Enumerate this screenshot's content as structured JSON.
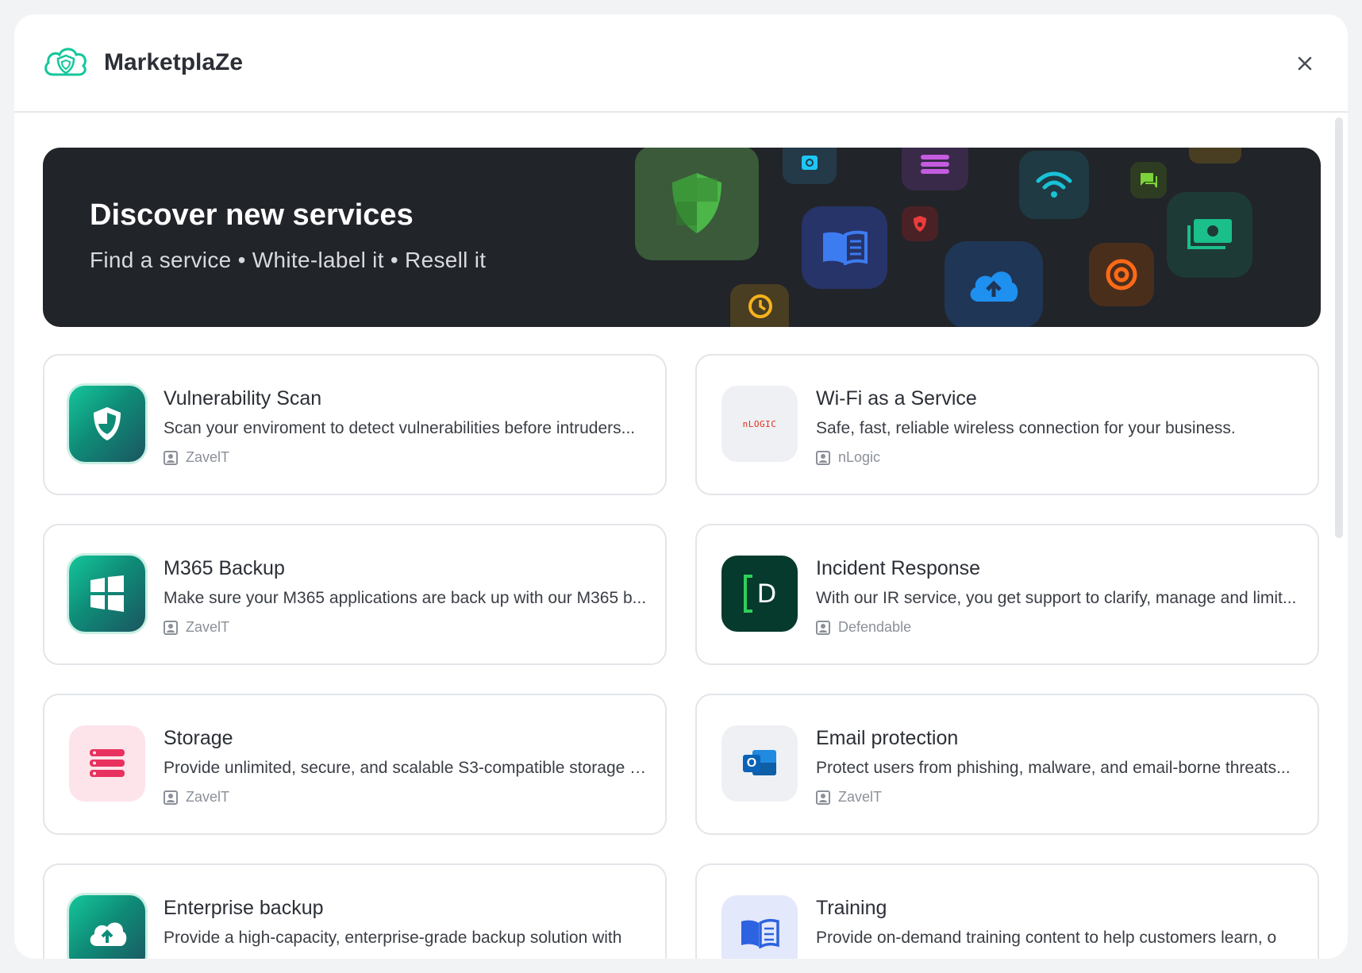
{
  "app": {
    "title": "MarketplaZe"
  },
  "banner": {
    "title": "Discover new services",
    "subtitle": "Find a service • White-label it • Resell it"
  },
  "services": [
    {
      "title": "Vulnerability Scan",
      "description": "Scan your enviroment to detect vulnerabilities before intruders...",
      "vendor": "ZavelT",
      "icon": "shield-icon"
    },
    {
      "title": "Wi-Fi as a Service",
      "description": "Safe, fast, reliable wireless connection for your business.",
      "vendor": "nLogic",
      "icon": "nlogic-logo",
      "logo_text": "nLOGIC"
    },
    {
      "title": "M365 Backup",
      "description": "Make sure your M365 applications are back up with our M365 b...",
      "vendor": "ZavelT",
      "icon": "windows-icon"
    },
    {
      "title": "Incident Response",
      "description": "With our IR service, you get support to clarify, manage and limit...",
      "vendor": "Defendable",
      "icon": "defendable-logo",
      "logo_text": "D"
    },
    {
      "title": "Storage",
      "description": "Provide unlimited, secure, and scalable S3-compatible storage t...",
      "vendor": "ZavelT",
      "icon": "storage-icon"
    },
    {
      "title": "Email protection",
      "description": "Protect users from phishing, malware, and email-borne threats...",
      "vendor": "ZavelT",
      "icon": "outlook-icon",
      "logo_text": "O"
    },
    {
      "title": "Enterprise backup",
      "description": "Provide a high-capacity, enterprise-grade backup solution with",
      "vendor": "",
      "icon": "cloud-upload-icon"
    },
    {
      "title": "Training",
      "description": "Provide on-demand training content to help customers learn, o",
      "vendor": "",
      "icon": "book-icon"
    }
  ],
  "colors": {
    "accent": "#14c79a",
    "banner_bg": "#212429",
    "brand_teal": "#0f8c78"
  }
}
